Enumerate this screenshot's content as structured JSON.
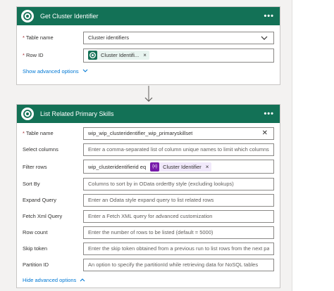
{
  "colors": {
    "header": "#137156",
    "link": "#0078d4",
    "required": "#a4262c",
    "variable_token": "#7719aa"
  },
  "card1": {
    "title": "Get Cluster Identifier",
    "menu": "•••",
    "table_label": "Table name",
    "table_value": "Cluster identifiers",
    "rowid_label": "Row ID",
    "rowid_token": "Cluster Identifi...",
    "token_remove": "×",
    "advanced_link": "Show advanced options"
  },
  "card2": {
    "title": "List Related Primary Skills",
    "menu": "•••",
    "table_label": "Table name",
    "table_value": "wip_wip_clusteridentifier_wip_primaryskillset",
    "clear": "✕",
    "select_label": "Select columns",
    "select_placeholder": "Enter a comma-separated list of column unique names to limit which columns",
    "filter_label": "Filter rows",
    "filter_value": "wip_clusteridentifierid eq",
    "filter_token_badge": "{x}",
    "filter_token": "Cluster Identifier",
    "token_remove": "×",
    "sort_label": "Sort By",
    "sort_placeholder": "Columns to sort by in OData orderBy style (excluding lookups)",
    "expand_label": "Expand Query",
    "expand_placeholder": "Enter an Odata style expand query to list related rows",
    "fetch_label": "Fetch Xml Query",
    "fetch_placeholder": "Enter a Fetch XML query for advanced customization",
    "rowcount_label": "Row count",
    "rowcount_placeholder": "Enter the number of rows to be listed (default = 5000)",
    "skip_label": "Skip token",
    "skip_placeholder": "Enter the skip token obtained from a previous run to list rows from the next pa",
    "partition_label": "Partition ID",
    "partition_placeholder": "An option to specify the partitionId while retrieving data for NoSQL tables",
    "advanced_link": "Hide advanced options"
  },
  "icons": [
    "dataverse-icon",
    "chevron-down-icon",
    "chevron-up-icon",
    "close-icon",
    "arrow-down-icon",
    "more-icon"
  ]
}
